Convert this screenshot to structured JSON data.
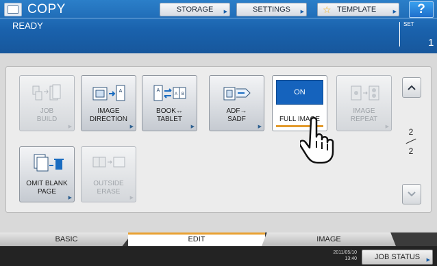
{
  "header": {
    "app_title": "COPY",
    "status": "READY",
    "buttons": {
      "storage": "STORAGE",
      "settings": "SETTINGS",
      "template": "TEMPLATE",
      "help": "?"
    },
    "set_label": "SET",
    "set_count": "1"
  },
  "functions": {
    "job_build": {
      "label": "JOB\nBUILD",
      "enabled": false,
      "icon": "job-build-icon"
    },
    "image_direction": {
      "label": "IMAGE\nDIRECTION",
      "enabled": true,
      "icon": "image-direction-icon"
    },
    "book_tablet": {
      "label": "BOOK↔\nTABLET",
      "enabled": true,
      "icon": "book-tablet-icon"
    },
    "adf_sadf": {
      "label": "ADF→\nSADF",
      "enabled": true,
      "icon": "adf-sadf-icon"
    },
    "full_image": {
      "state": "ON",
      "label": "FULL IMAGE",
      "enabled": true,
      "selected": true
    },
    "image_repeat": {
      "label": "IMAGE\nREPEAT",
      "enabled": false,
      "icon": "image-repeat-icon"
    },
    "omit_blank_page": {
      "label": "OMIT BLANK\nPAGE",
      "enabled": true,
      "icon": "omit-blank-page-icon"
    },
    "outside_erase": {
      "label": "OUTSIDE\nERASE",
      "enabled": false,
      "icon": "outside-erase-icon"
    }
  },
  "pagination": {
    "current": "2",
    "total": "2"
  },
  "tabs": [
    {
      "label": "BASIC",
      "active": false
    },
    {
      "label": "EDIT",
      "active": true
    },
    {
      "label": "IMAGE",
      "active": false
    }
  ],
  "footer": {
    "date": "2011/05/10",
    "time": "13:40",
    "job_status": "JOB STATUS"
  },
  "colors": {
    "header_blue": "#1a62ad",
    "active_blue": "#1563bd",
    "accent_orange": "#e29a2c"
  }
}
